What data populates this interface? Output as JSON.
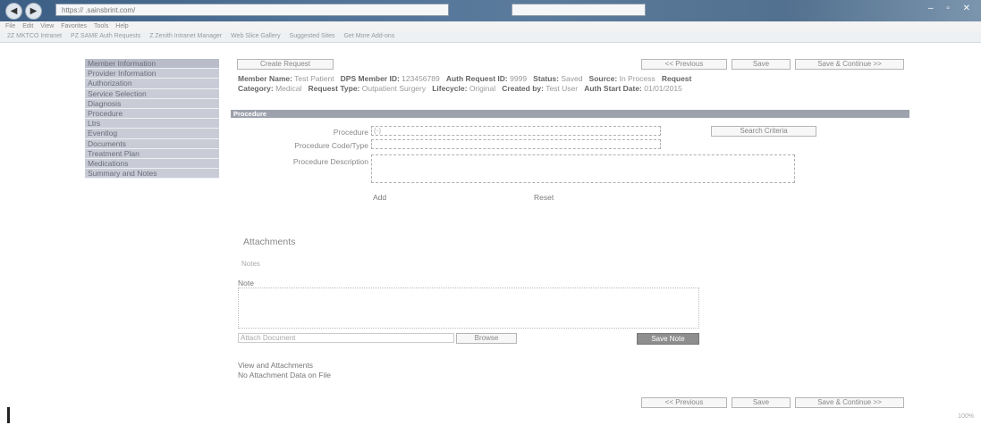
{
  "browser": {
    "address": "https://              .sainsbrint.com/",
    "tab_text": "",
    "back_icon": "back-arrow-icon",
    "forward_icon": "forward-arrow-icon",
    "menu": [
      "File",
      "Edit",
      "View",
      "Favorites",
      "Tools",
      "Help"
    ],
    "favorites": [
      "2Z MKTCO Intranet",
      "PZ SAME Auth Requests",
      "Z Zenith Intranet Manager",
      "Web Slice Gallery",
      "Suggested Sites",
      "Get More Add-ons"
    ],
    "window_controls": "– ▫ ✕",
    "zoom": "100%"
  },
  "nav": {
    "items": [
      "Member Information",
      "Provider Information",
      "Authorization",
      "Service Selection",
      "Diagnosis",
      "Procedure",
      "Ltrs",
      "Eventlog",
      "Documents",
      "Treatment Plan",
      "Medications",
      "Summary and Notes"
    ]
  },
  "toolbar": {
    "create_request": "Create Request",
    "previous": "<< Previous",
    "save": "Save",
    "save_continue": "Save & Continue >>"
  },
  "member_info": {
    "member_name_label": "Member Name:",
    "member_name": "Test Patient",
    "mbr_id_label": "DPS Member ID:",
    "mbr_id": "123456789",
    "auth_request_label": "Auth Request ID:",
    "auth_request": "9999",
    "status_label": "Status:",
    "status": "Saved",
    "source_label": "Source:",
    "source": "In Process",
    "request_label": "Request",
    "category_label": "Category:",
    "category": "Medical",
    "request_type_label": "Request Type:",
    "request_type": "Outpatient Surgery",
    "lifecycle_label": "Lifecycle:",
    "lifecycle": "Original",
    "created_by_label": "Created by:",
    "created_by": "Test User",
    "auth_start_label": "Auth Start Date:",
    "auth_start": "01/01/2015"
  },
  "section": {
    "title": "Procedure"
  },
  "form": {
    "procedure_label": "Procedure",
    "procedure_value": "(-)",
    "search_button": "Search Criteria",
    "procedure_code_label": "Procedure Code/Type",
    "procedure_desc_label": "Procedure Description",
    "add_label": "Add",
    "reset_label": "Reset"
  },
  "attachments": {
    "title": "Attachments",
    "subtitle": "Notes",
    "note_label": "Note",
    "attach_placeholder": "Attach Document",
    "browse_label": "Browse",
    "save_note_label": "Save Note"
  },
  "footer": {
    "view_attachments": "View and Attachments",
    "no_attachment": "No Attachment Data on File",
    "previous": "<< Previous",
    "save": "Save",
    "save_continue": "Save & Continue >>"
  }
}
